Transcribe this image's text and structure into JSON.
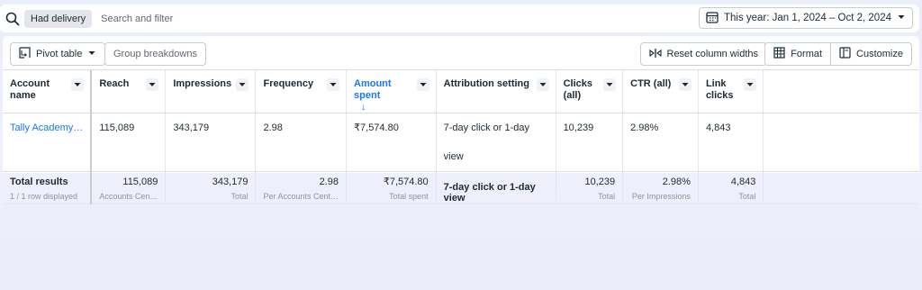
{
  "filter_bar": {
    "chip_label": "Had delivery",
    "search_placeholder": "Search and filter",
    "date_range_label": "This year: Jan 1, 2024 – Oct 2, 2024"
  },
  "toolbar": {
    "pivot_table_label": "Pivot table",
    "group_breakdowns_label": "Group breakdowns",
    "reset_column_widths_label": "Reset column widths",
    "format_label": "Format",
    "customize_label": "Customize"
  },
  "table": {
    "columns": [
      {
        "label": "Account name"
      },
      {
        "label": "Reach"
      },
      {
        "label": "Impressions"
      },
      {
        "label": "Frequency"
      },
      {
        "label": "Amount spent",
        "sorted": "desc"
      },
      {
        "label": "Attribution setting"
      },
      {
        "label": "Clicks (all)"
      },
      {
        "label": "CTR (all)"
      },
      {
        "label": "Link clicks"
      }
    ],
    "rows": [
      {
        "account_name": "Tally Academy…",
        "reach": "115,089",
        "impressions": "343,179",
        "frequency": "2.98",
        "amount_spent": "₹7,574.80",
        "attribution_setting": "7-day click or 1-day view",
        "clicks_all": "10,239",
        "ctr_all": "2.98%",
        "link_clicks": "4,843"
      }
    ],
    "total": {
      "label": "Total results",
      "sublabel": "1 / 1 row displayed",
      "reach": "115,089",
      "reach_sub": "Accounts Cen…",
      "impressions": "343,179",
      "impressions_sub": "Total",
      "frequency": "2.98",
      "frequency_sub": "Per Accounts Cent…",
      "amount_spent": "₹7,574.80",
      "amount_spent_sub": "Total spent",
      "attribution_setting": "7-day click or 1-day view",
      "clicks_all": "10,239",
      "clicks_all_sub": "Total",
      "ctr_all": "2.98%",
      "ctr_all_sub": "Per Impressions",
      "link_clicks": "4,843",
      "link_clicks_sub": "Total"
    }
  },
  "colors": {
    "accent": "#1877f2",
    "text": "#1c2b33",
    "muted": "#8d949e"
  }
}
